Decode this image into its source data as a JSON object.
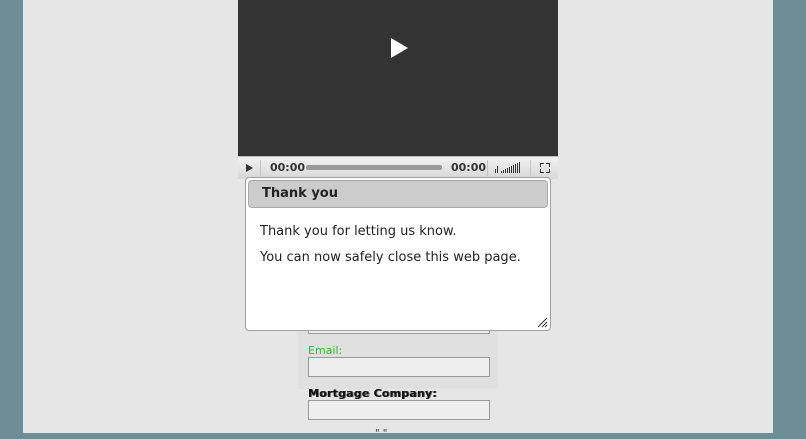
{
  "video": {
    "time_current": "00:00",
    "time_total": "00:00"
  },
  "dialog": {
    "title": "Thank you",
    "line1": "Thank you for letting us know.",
    "line2": "You can now safely close this web page."
  },
  "form": {
    "email_label": "Email:",
    "mortgage_label": "Mortgage Company:",
    "cut_off_text": "\" \""
  },
  "colors": {
    "outer_bg": "#6e8e97",
    "page_bg": "#e6e6e6",
    "video_bg": "#333333",
    "email_label": "#44aa44"
  },
  "icons": [
    "play-icon",
    "volume-icon",
    "fullscreen-icon",
    "resize-handle-icon"
  ]
}
